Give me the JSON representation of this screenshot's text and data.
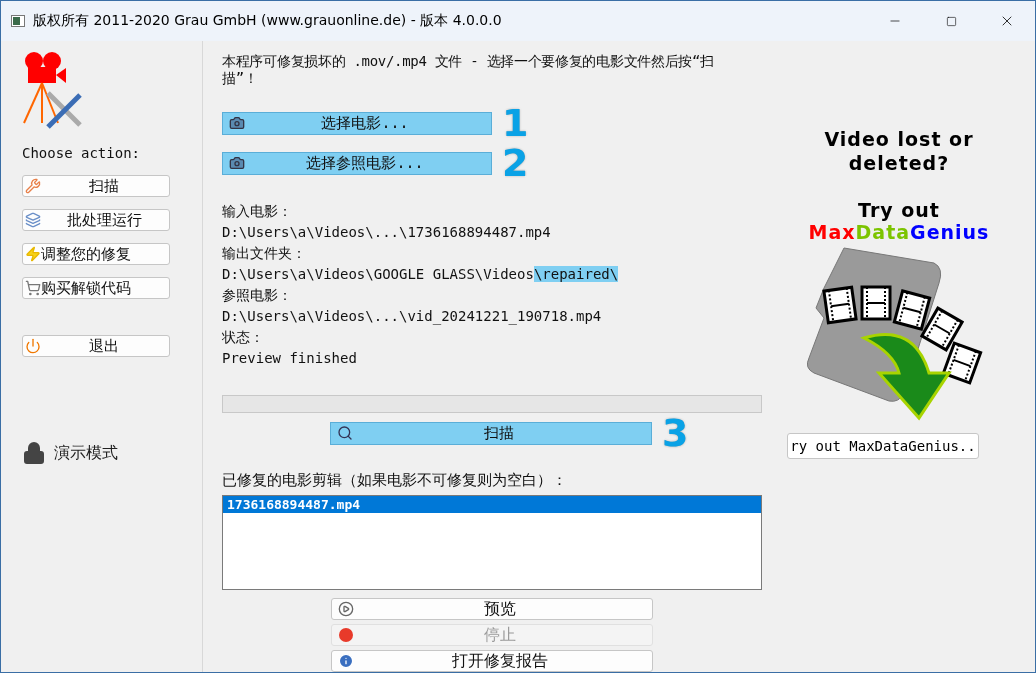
{
  "window": {
    "title": "版权所有 2011-2020 Grau GmbH (www.grauonline.de) - 版本 4.0.0.0"
  },
  "sidebar": {
    "heading": "Choose action:",
    "actions": [
      {
        "label": "扫描"
      },
      {
        "label": "批处理运行"
      },
      {
        "label": "调整您的修复"
      },
      {
        "label": "购买解锁代码"
      }
    ],
    "exit_button": {
      "label": "退出"
    },
    "mode": "演示模式"
  },
  "main": {
    "intro": "本程序可修复损坏的 .mov/.mp4 文件 - 选择一个要修复的电影文件然后按“扫描”！",
    "select_buttons": [
      {
        "label": "选择电影...",
        "step": "1"
      },
      {
        "label": "选择参照电影...",
        "step": "2"
      }
    ],
    "info": [
      {
        "label": "输入电影：",
        "value": "D:\\Users\\a\\Videos\\...\\1736168894487.mp4"
      },
      {
        "label": "输出文件夹：",
        "value": "D:\\Users\\a\\Videos\\GOOGLE GLASS\\Videos",
        "highlight": "\\repaired\\"
      },
      {
        "label": "参照电影：",
        "value": "D:\\Users\\a\\Videos\\...\\vid_20241221_190718.mp4"
      },
      {
        "label": "状态：",
        "value": "Preview finished"
      }
    ],
    "progress": {
      "level": 0
    },
    "scan_button": {
      "label": "扫描",
      "step": "3"
    },
    "results_label": "已修复的电影剪辑（如果电影不可修复则为空白）：",
    "results": [
      {
        "name": "1736168894487.mp4",
        "selected": true
      }
    ],
    "bottom_buttons": [
      {
        "label": "预览",
        "disabled": false
      },
      {
        "label": "停止",
        "disabled": true
      },
      {
        "label": "打开修复报告",
        "disabled": false
      }
    ]
  },
  "ad": {
    "headline": "Video lost or deleted?",
    "try": "Try out",
    "brand": [
      {
        "text": "Max",
        "color": "#ff0000"
      },
      {
        "text": "Data",
        "color": "#7cc400"
      },
      {
        "text": "Genius",
        "color": "#0000ff"
      }
    ],
    "button": "ry out MaxDataGenius.."
  }
}
